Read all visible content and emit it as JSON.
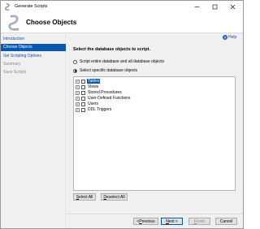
{
  "window": {
    "title": "Generate Scripts",
    "app_icon": "script-wizard-icon",
    "controls": [
      "minimize-icon",
      "maximize-icon",
      "close-icon"
    ]
  },
  "header": {
    "title": "Choose Objects",
    "icon": "script-scroll-icon"
  },
  "sidebar": {
    "items": [
      {
        "label": "Introduction",
        "state": "link"
      },
      {
        "label": "Choose Objects",
        "state": "selected"
      },
      {
        "label": "Set Scripting Options",
        "state": "link"
      },
      {
        "label": "Summary",
        "state": "disabled"
      },
      {
        "label": "Save Scripts",
        "state": "disabled"
      }
    ]
  },
  "main": {
    "help_label": "Help",
    "instruction": "Select the database objects to script.",
    "options": [
      {
        "label": "Script entire database and all database objects",
        "checked": false
      },
      {
        "label": "Select specific database objects",
        "checked": true
      }
    ],
    "tree": [
      {
        "label": "Tables",
        "selected": true
      },
      {
        "label": "Views",
        "selected": false
      },
      {
        "label": "Stored Procedures",
        "selected": false
      },
      {
        "label": "User-Defined Functions",
        "selected": false
      },
      {
        "label": "Users",
        "selected": false
      },
      {
        "label": "DDL Triggers",
        "selected": false
      }
    ],
    "select_all": {
      "mnemonic": "S",
      "rest": "elect All"
    },
    "deselect_all": {
      "mnemonic": "D",
      "rest": "eselect All"
    }
  },
  "footer": {
    "previous": {
      "prefix": "< ",
      "mnemonic": "P",
      "rest": "revious"
    },
    "next": {
      "mnemonic": "N",
      "rest": "ext >"
    },
    "finish": {
      "mnemonic": "F",
      "rest": "inish"
    },
    "cancel": "Cancel"
  },
  "colors": {
    "selection": "#0a57b0",
    "link": "#1a4fa0",
    "disabled": "#8a8a8a",
    "background": "#f0f0f0"
  }
}
